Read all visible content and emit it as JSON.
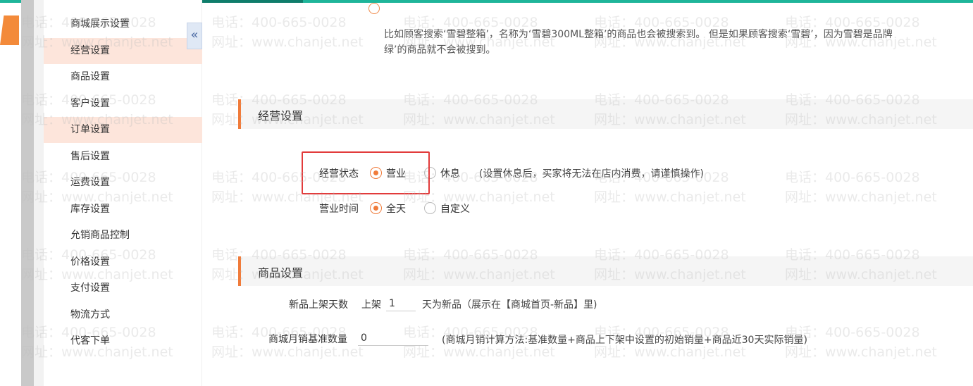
{
  "sidebar": {
    "collapse_glyph": "«",
    "items": [
      {
        "label": "商城展示设置",
        "active": false
      },
      {
        "label": "经营设置",
        "active": true
      },
      {
        "label": "商品设置",
        "active": false
      },
      {
        "label": "客户设置",
        "active": false
      },
      {
        "label": "订单设置",
        "active": true
      },
      {
        "label": "售后设置",
        "active": false
      },
      {
        "label": "运费设置",
        "active": false
      },
      {
        "label": "库存设置",
        "active": false
      },
      {
        "label": "允销商品控制",
        "active": false
      },
      {
        "label": "价格设置",
        "active": false
      },
      {
        "label": "支付设置",
        "active": false
      },
      {
        "label": "物流方式",
        "active": false
      },
      {
        "label": "代客下单",
        "active": false
      }
    ]
  },
  "intro": {
    "line1": "比如顾客搜索‘雪碧整箱’，名称为‘雪碧300ML整箱’的商品也会被搜索到。 但是如果顾客搜索‘雪碧’，因为雪碧是品牌",
    "line2": "绿’的商品就不会被搜到。"
  },
  "business": {
    "section_title": "经营设置",
    "status_label": "经营状态",
    "status_options": [
      "营业",
      "休息"
    ],
    "status_selected": "营业",
    "status_hint": "(设置休息后，买家将无法在店内消费，请谨慎操作)",
    "hours_label": "营业时间",
    "hours_options": [
      "全天",
      "自定义"
    ],
    "hours_selected": "全天"
  },
  "product": {
    "section_title": "商品设置",
    "new_days_label": "新品上架天数",
    "new_days_prefix": "上架",
    "new_days_value": "1",
    "new_days_suffix": "天为新品（展示在【商城首页-新品】里)",
    "monthly_label": "商城月销基准数量",
    "monthly_value": "0",
    "monthly_hint": "(商城月销计算方法:基准数量+商品上下架中设置的初始销量+商品近30天实际销量)"
  },
  "watermark": {
    "phone": "电话：400-665-0028",
    "site": "网址：www.chanjet.net"
  },
  "colors": {
    "accent": "#f07b3a",
    "topbar": "#1fb59a",
    "highlight_box": "#e23b3b",
    "active_item_bg": "#fde5db"
  }
}
